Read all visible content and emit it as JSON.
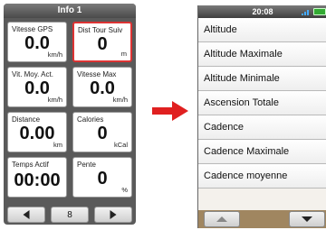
{
  "left": {
    "header": "Info 1",
    "tiles": [
      {
        "label": "Vitesse GPS",
        "value": "0.0",
        "unit": "km/h",
        "highlighted": false
      },
      {
        "label": "Dist Tour Suiv",
        "value": "0",
        "unit": "m",
        "highlighted": true
      },
      {
        "label": "Vit. Moy. Act.",
        "value": "0.0",
        "unit": "km/h",
        "highlighted": false
      },
      {
        "label": "Vitesse Max",
        "value": "0.0",
        "unit": "km/h",
        "highlighted": false
      },
      {
        "label": "Distance",
        "value": "0.00",
        "unit": "km",
        "highlighted": false
      },
      {
        "label": "Calories",
        "value": "0",
        "unit": "kCal",
        "highlighted": false
      },
      {
        "label": "Temps Actif",
        "value": "00:00",
        "unit": "",
        "highlighted": false
      },
      {
        "label": "Pente",
        "value": "0",
        "unit": "%",
        "highlighted": false
      }
    ],
    "footer": {
      "prev_icon": "triangle-left-icon",
      "page_number": "8",
      "next_icon": "triangle-right-icon"
    }
  },
  "arrow_color": "#e02020",
  "right": {
    "status": {
      "time": "20:08",
      "signal_icon": "signal-bars-icon",
      "battery_icon": "battery-icon"
    },
    "items": [
      "Altitude",
      "Altitude Maximale",
      "Altitude Minimale",
      "Ascension Totale",
      "Cadence",
      "Cadence Maximale",
      "Cadence moyenne"
    ],
    "footer": {
      "up_icon": "triangle-up-icon",
      "down_icon": "triangle-down-icon"
    }
  }
}
